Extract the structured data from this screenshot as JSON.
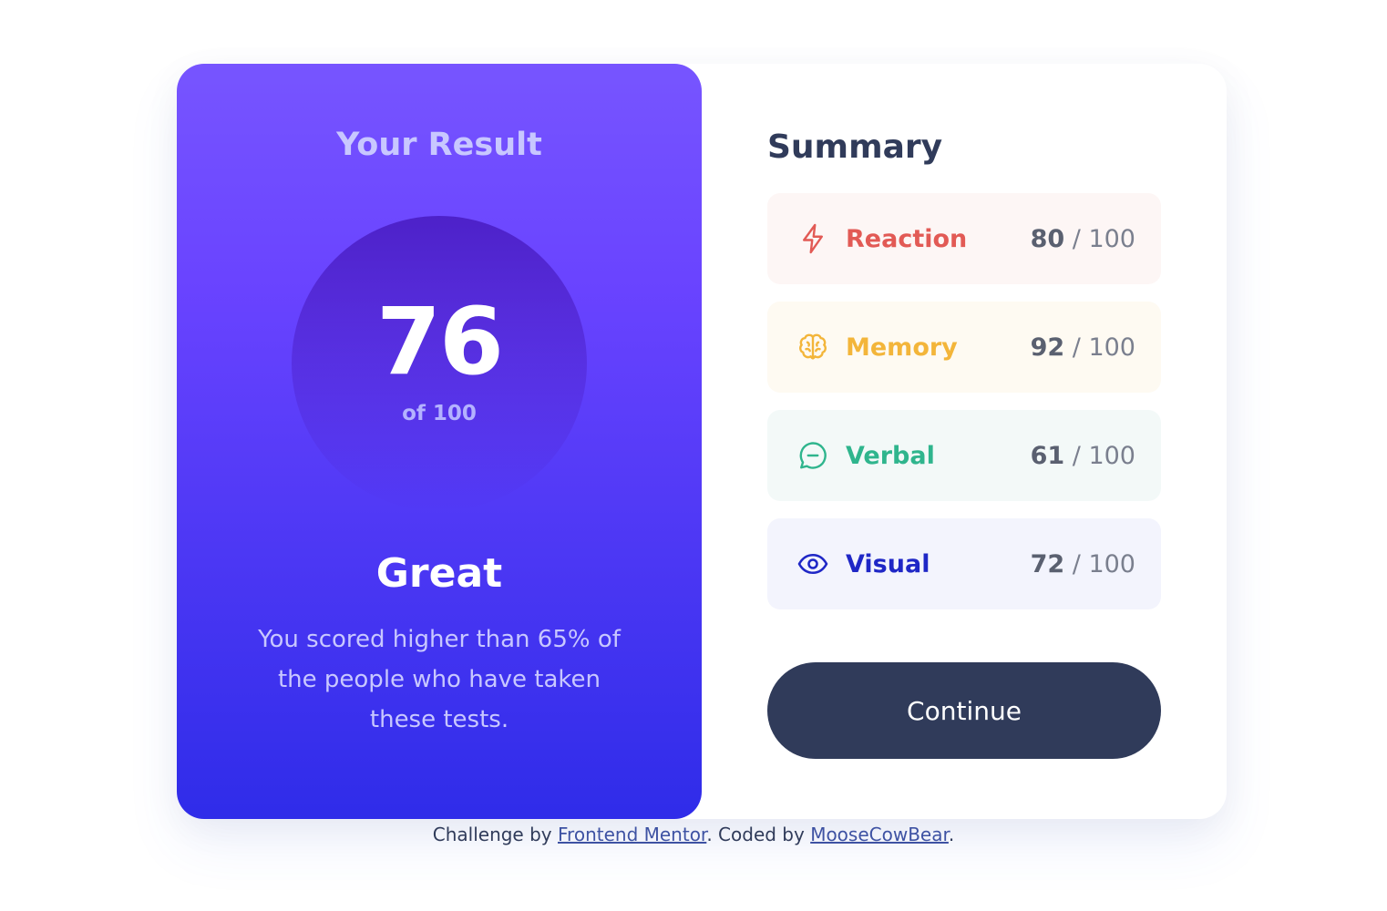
{
  "result": {
    "title": "Your Result",
    "score": "76",
    "score_of": "of 100",
    "rating": "Great",
    "description": "You scored higher than 65% of the people who have taken these tests."
  },
  "summary": {
    "title": "Summary",
    "items": [
      {
        "label": "Reaction",
        "score": "80",
        "sep": " / ",
        "max": "100",
        "icon": "lightning-icon",
        "color": "#E25A55",
        "background": "#FDF6F5"
      },
      {
        "label": "Memory",
        "score": "92",
        "sep": " / ",
        "max": "100",
        "icon": "brain-icon",
        "color": "#F3B53A",
        "background": "#FEFAF2"
      },
      {
        "label": "Verbal",
        "score": "61",
        "sep": " / ",
        "max": "100",
        "icon": "chat-bubble-icon",
        "color": "#2FB58D",
        "background": "#F3F9F8"
      },
      {
        "label": "Visual",
        "score": "72",
        "sep": " / ",
        "max": "100",
        "icon": "eye-icon",
        "color": "#1F27C6",
        "background": "#F3F4FD"
      }
    ]
  },
  "continue_label": "Continue",
  "attribution": {
    "prefix": "Challenge by ",
    "link1": "Frontend Mentor",
    "middle": ". Coded by ",
    "link2": "MooseCowBear",
    "suffix": "."
  },
  "colors": {
    "gradient_top": "#7755FF",
    "gradient_bottom": "#2F2CE9",
    "button": "#303B5A"
  }
}
